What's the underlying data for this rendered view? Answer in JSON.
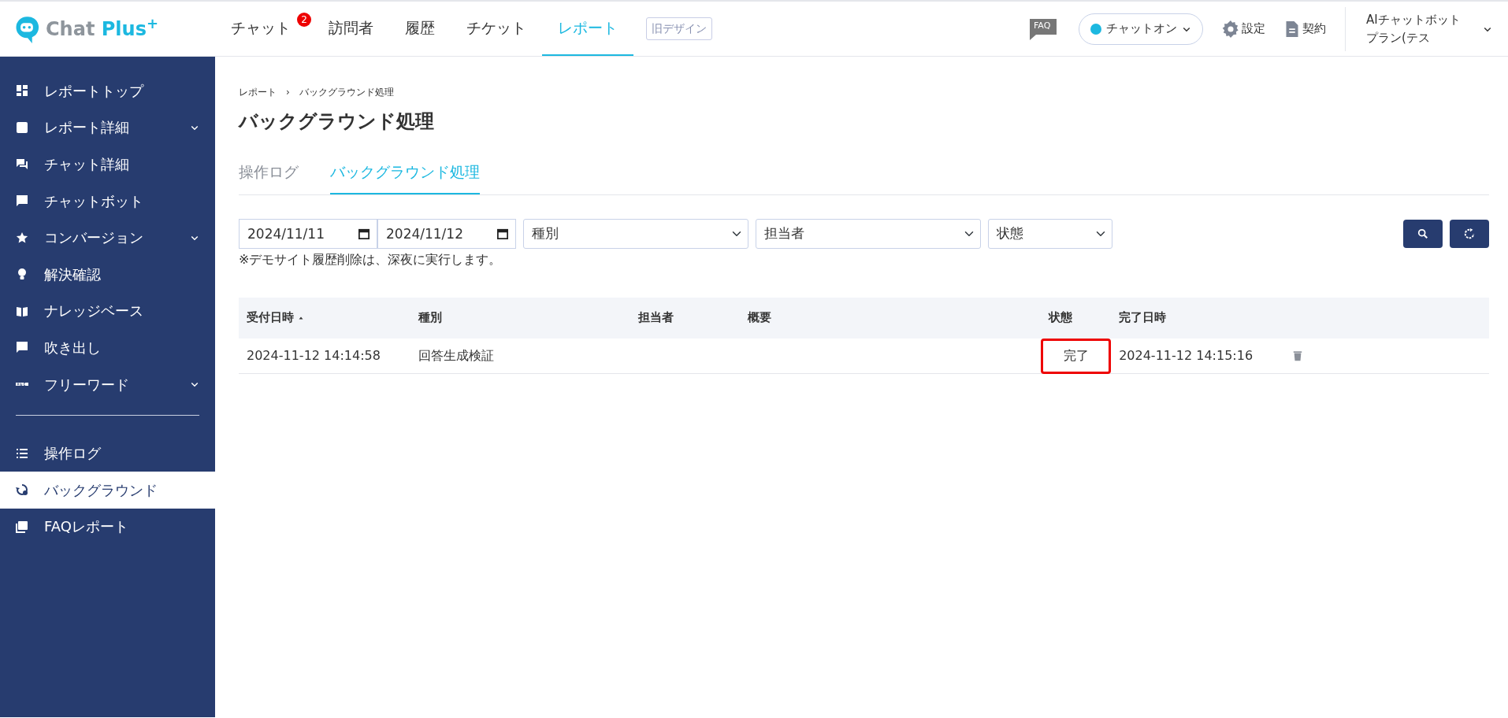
{
  "header": {
    "logo": {
      "text": "Chat Plus",
      "mark": "+"
    },
    "nav": [
      {
        "label": "チャット",
        "badge": "2",
        "selected": false
      },
      {
        "label": "訪問者",
        "selected": false
      },
      {
        "label": "履歴",
        "selected": false
      },
      {
        "label": "チケット",
        "selected": false
      },
      {
        "label": "レポート",
        "selected": true
      }
    ],
    "old_design": "旧デザイン",
    "faq": "FAQ",
    "chat_status": {
      "label": "チャットオン",
      "on": true
    },
    "settings": "設定",
    "contract": "契約",
    "account": "AIチャットボットプラン(テス"
  },
  "sidebar": {
    "items": [
      {
        "label": "レポートトップ",
        "expandable": false,
        "selected": false
      },
      {
        "label": "レポート詳細",
        "expandable": true,
        "selected": false
      },
      {
        "label": "チャット詳細",
        "expandable": false,
        "selected": false
      },
      {
        "label": "チャットボット",
        "expandable": false,
        "selected": false
      },
      {
        "label": "コンバージョン",
        "expandable": true,
        "selected": false
      },
      {
        "label": "解決確認",
        "expandable": false,
        "selected": false
      },
      {
        "label": "ナレッジベース",
        "expandable": false,
        "selected": false
      },
      {
        "label": "吹き出し",
        "expandable": false,
        "selected": false
      },
      {
        "label": "フリーワード",
        "expandable": true,
        "selected": false
      }
    ],
    "items_2": [
      {
        "label": "操作ログ",
        "expandable": false,
        "selected": false
      },
      {
        "label": "バックグラウンド",
        "expandable": false,
        "selected": true
      },
      {
        "label": "FAQレポート",
        "expandable": false,
        "selected": false
      }
    ]
  },
  "breadcrumb": [
    "レポート",
    "バックグラウンド処理"
  ],
  "breadcrumb_separator": "›",
  "title": "バックグラウンド処理",
  "tabs": [
    {
      "label": "操作ログ",
      "selected": false
    },
    {
      "label": "バックグラウンド処理",
      "selected": true
    }
  ],
  "filters": {
    "date_from": "2024/11/11",
    "date_to": "2024/11/12",
    "selects": [
      "種別",
      "担当者",
      "状態"
    ]
  },
  "note": "※デモサイト履歴削除は、深夜に実行します。",
  "table": {
    "columns": [
      {
        "label": "受付日時",
        "sorted": true
      },
      {
        "label": "種別",
        "sorted": false
      },
      {
        "label": "担当者",
        "sorted": false
      },
      {
        "label": "概要",
        "sorted": false
      },
      {
        "label": "状態",
        "sorted": false
      },
      {
        "label": "完了日時",
        "sorted": false
      }
    ],
    "rows": [
      {
        "cells": [
          {
            "text": "2024-11-12 14:14:58",
            "highlighted": false
          },
          {
            "text": "回答生成検証",
            "highlighted": false
          },
          {
            "highlighted": false
          },
          {
            "highlighted": false
          },
          {
            "text": "完了",
            "highlighted": true
          },
          {
            "text": "2024-11-12 14:15:16",
            "highlighted": false
          }
        ]
      }
    ]
  }
}
